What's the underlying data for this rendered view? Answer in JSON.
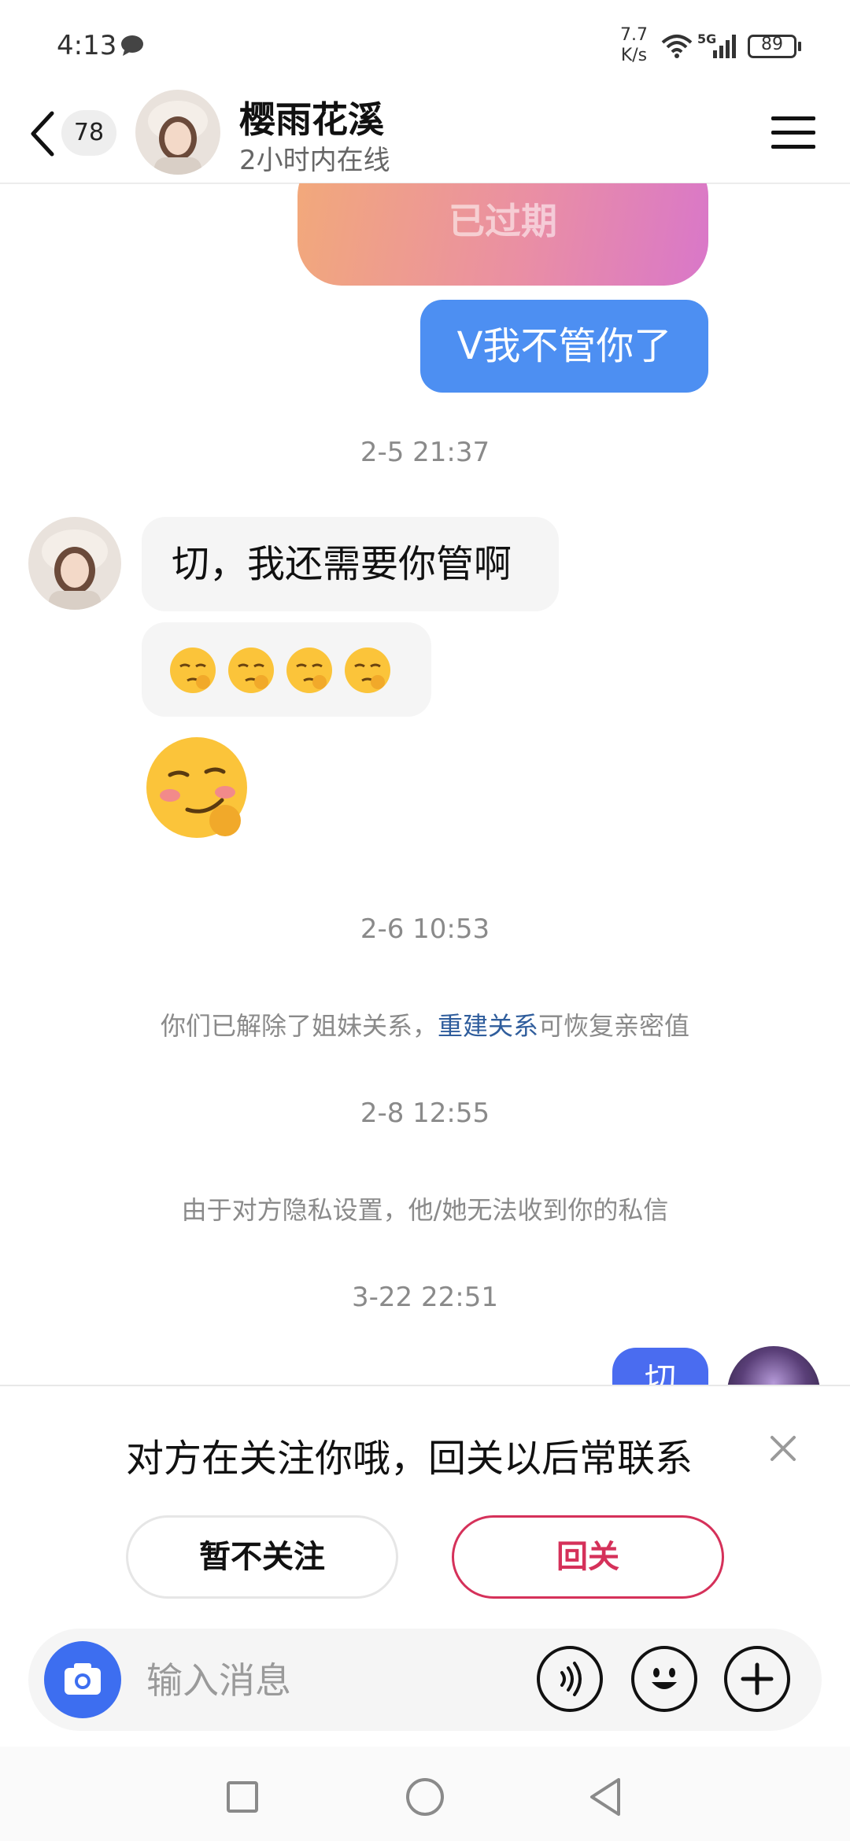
{
  "status_bar": {
    "time": "4:13",
    "net_speed_value": "7.7",
    "net_speed_unit": "K/s",
    "network_type": "5G",
    "battery": "89"
  },
  "header": {
    "unread_count": "78",
    "contact_name": "樱雨花溪",
    "contact_status": "2小时内在线"
  },
  "chat": {
    "card_text": "已过期",
    "sent_message_1": "V我不管你了",
    "timestamp_1": "2-5 21:37",
    "received_message_1": "切，我还需要你管啊",
    "timestamp_2": "2-6 10:53",
    "system_note_1_prefix": "你们已解除了姐妹关系，",
    "system_note_1_link": "重建关系",
    "system_note_1_suffix": "可恢复亲密值",
    "timestamp_3": "2-8 12:55",
    "system_note_2": "由于对方隐私设置，他/她无法收到你的私信",
    "timestamp_4": "3-22 22:51",
    "sent_message_partial": "切"
  },
  "follow_panel": {
    "prompt": "对方在关注你哦，回关以后常联系",
    "decline_label": "暂不关注",
    "follow_label": "回关"
  },
  "input_bar": {
    "placeholder": "输入消息"
  },
  "colors": {
    "sent_bubble": "#4d8ff2",
    "accent_red": "#d5315a",
    "camera_button": "#3d6ef0",
    "link": "#2f5d9c"
  },
  "icons": [
    "message-icon",
    "wifi-icon",
    "signal-icon",
    "battery-icon",
    "back-icon",
    "menu-icon",
    "close-icon",
    "camera-icon",
    "voice-icon",
    "emoji-icon",
    "plus-icon",
    "nav-recents-icon",
    "nav-home-icon",
    "nav-back-icon"
  ]
}
